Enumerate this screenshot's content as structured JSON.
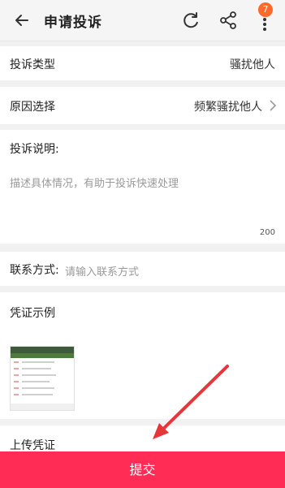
{
  "topbar": {
    "title": "申请投诉",
    "badge_count": "7",
    "icons": [
      "back-arrow-icon",
      "refresh-icon",
      "share-icon",
      "more-vertical-icon"
    ]
  },
  "form": {
    "complaint_type_label": "投诉类型",
    "complaint_type_value": "骚扰他人",
    "reason_label": "原因选择",
    "reason_value": "频繁骚扰他人",
    "description_label": "投诉说明:",
    "description_placeholder": "描述具体情况，有助于投诉快速处理",
    "description_limit": "200",
    "contact_label": "联系方式:",
    "contact_placeholder": "请输入联系方式",
    "evidence_example_label": "凭证示例",
    "upload_label": "上传凭证"
  },
  "actions": {
    "submit_label": "提交"
  },
  "colors": {
    "accent": "#ff2d55",
    "badge": "#ff6a2a",
    "annotation_arrow": "#e7353a"
  }
}
